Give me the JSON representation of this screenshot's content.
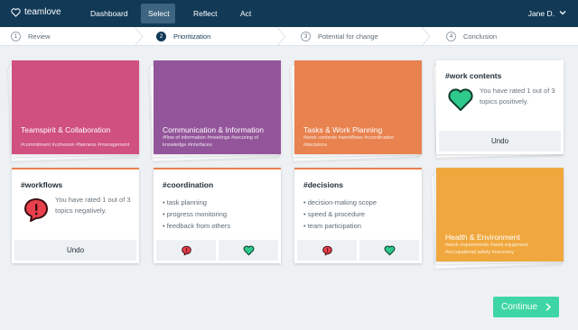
{
  "app": {
    "logo_text": "teamlove"
  },
  "nav": {
    "items": [
      {
        "label": "Dashboard"
      },
      {
        "label": "Select"
      },
      {
        "label": "Reflect"
      },
      {
        "label": "Act"
      }
    ],
    "user": "Jane D."
  },
  "stepper": {
    "steps": [
      {
        "num": "1",
        "label": "Review"
      },
      {
        "num": "2",
        "label": "Prioritization"
      },
      {
        "num": "3",
        "label": "Potential for change"
      },
      {
        "num": "4",
        "label": "Conclusion"
      }
    ]
  },
  "colors": {
    "teamspirit": "#d0507f",
    "communication": "#93559a",
    "tasks": "#e8824f",
    "health": "#f0a83e",
    "accent_green": "#3ed6a4",
    "heart_green": "#2fc98c",
    "alert_red": "#e8404d",
    "nav_bg": "#123a57"
  },
  "categories": {
    "teamspirit": {
      "title": "Teamspirit & Collaboration",
      "tags": "#commitment #cohesion #fairness #management"
    },
    "communication": {
      "title": "Communication & Information",
      "tags": "#flow of information #meetings #securing of knowledge #interfaces"
    },
    "tasks": {
      "title": "Tasks & Work Planning",
      "tags": "#work contents #workflows #coordination #decisions"
    },
    "health": {
      "title": "Health & Environment",
      "tags": "#work requirements #work equipment #occupational safety #recovery"
    }
  },
  "rated_cards": {
    "work_contents": {
      "title": "#work contents",
      "text": "You have rated 1 out of 3 topics positively.",
      "icon": "heart-icon",
      "undo": "Undo"
    },
    "workflows": {
      "title": "#workflows",
      "text": "You have rated 1 out of 3 topics negatively.",
      "icon": "alert-icon",
      "undo": "Undo"
    }
  },
  "topic_cards": {
    "coordination": {
      "title": "#coordination",
      "bullets": [
        "task planning",
        "progress monitoring",
        "feedback from others"
      ]
    },
    "decisions": {
      "title": "#decisions",
      "bullets": [
        "decision-making scope",
        "speed & procedure",
        "team participation"
      ]
    }
  },
  "continue_label": "Continue"
}
